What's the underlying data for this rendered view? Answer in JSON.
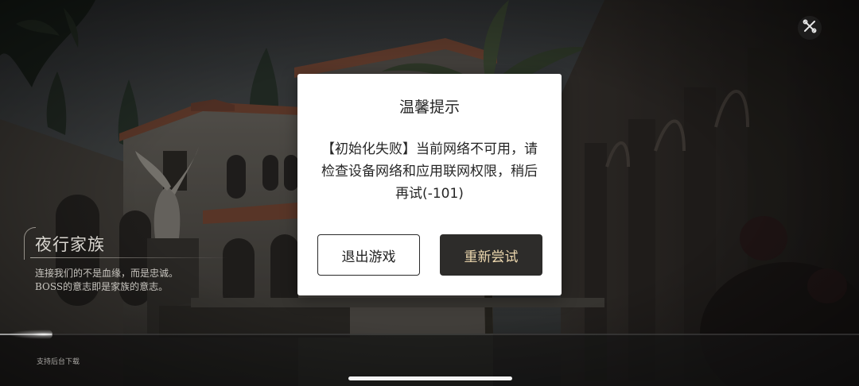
{
  "dialog": {
    "title": "温馨提示",
    "message": "【初始化失败】当前网络不可用，请检查设备网络和应用联网权限，稍后再试(-101)",
    "exit_label": "退出游戏",
    "retry_label": "重新尝试"
  },
  "loading": {
    "title": "夜行家族",
    "desc_line1": "连接我们的不是血缘，而是忠诚。",
    "desc_line2": "BOSS的意志即是家族的意志。",
    "progress": 0.06
  },
  "footer": {
    "download_hint": "支持后台下载"
  },
  "icons": {
    "tools": "tools-icon"
  },
  "colors": {
    "retry_button_bg": "#2d2c2a",
    "retry_button_text": "#ecd7ae",
    "dialog_bg": "#ffffff"
  }
}
